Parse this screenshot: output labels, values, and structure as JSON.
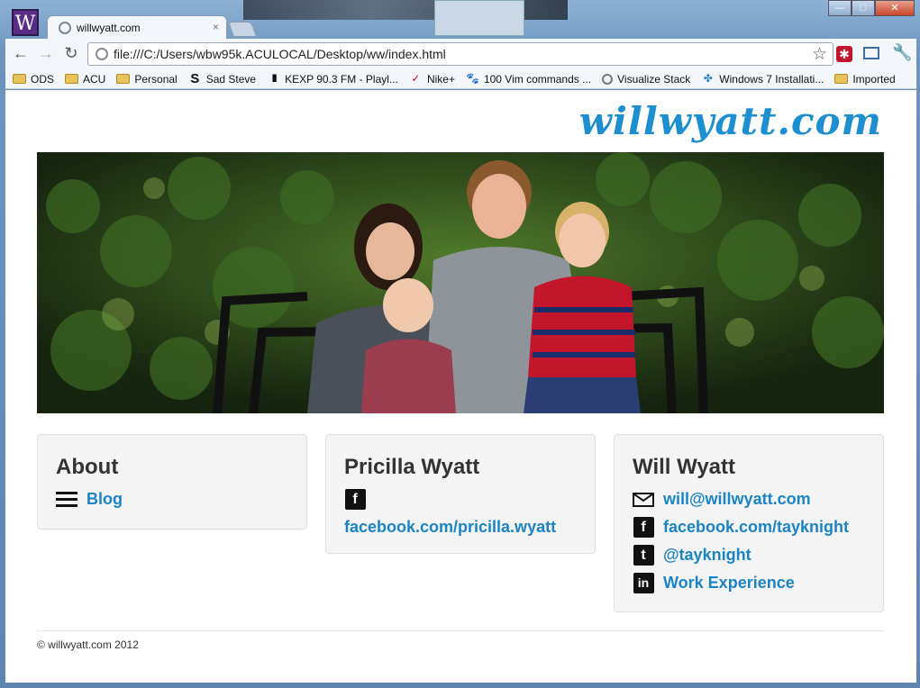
{
  "window": {
    "tab_title": "willwyatt.com",
    "tab_close": "×",
    "app_icon_letter": "W",
    "min": "—",
    "max": "□",
    "close": "✕"
  },
  "toolbar": {
    "back": "←",
    "forward": "→",
    "reload": "↻",
    "url": "file:///C:/Users/wbw95k.ACULOCAL/Desktop/ww/index.html",
    "star": "☆",
    "ext_red": "✱",
    "wrench": "🔧"
  },
  "bookmarks": [
    {
      "label": "ODS",
      "icon": "folder-icon"
    },
    {
      "label": "ACU",
      "icon": "folder-icon"
    },
    {
      "label": "Personal",
      "icon": "folder-icon"
    },
    {
      "label": "Sad Steve",
      "icon": "s-logo-icon",
      "glyph": "S"
    },
    {
      "label": "KEXP 90.3 FM - Playl...",
      "icon": "bars-icon",
      "glyph": "III"
    },
    {
      "label": "Nike+",
      "icon": "swoosh-icon",
      "glyph": "✓"
    },
    {
      "label": "100 Vim commands ...",
      "icon": "paw-icon",
      "glyph": "🐾"
    },
    {
      "label": "Visualize Stack",
      "icon": "globe-icon"
    },
    {
      "label": "Windows 7 Installati...",
      "icon": "pinwheel-icon",
      "glyph": "✤"
    },
    {
      "label": "Imported",
      "icon": "folder-icon"
    }
  ],
  "site": {
    "brand": "willwyatt.com",
    "about": {
      "heading": "About",
      "links": [
        {
          "label": "Blog",
          "icon": "menu-icon"
        }
      ]
    },
    "pricilla": {
      "heading": "Pricilla Wyatt",
      "icon": "facebook-icon",
      "link": "facebook.com/pricilla.wyatt"
    },
    "will": {
      "heading": "Will Wyatt",
      "links": [
        {
          "label": "will@willwyatt.com",
          "icon": "mail-icon"
        },
        {
          "label": "facebook.com/tayknight",
          "icon": "facebook-icon"
        },
        {
          "label": "@tayknight",
          "icon": "twitter-icon"
        },
        {
          "label": "Work Experience",
          "icon": "linkedin-icon"
        }
      ]
    },
    "footer": "© willwyatt.com 2012"
  },
  "colors": {
    "link": "#1a84c7",
    "brand": "#1d8fd0",
    "card_bg": "#f4f4f4"
  }
}
